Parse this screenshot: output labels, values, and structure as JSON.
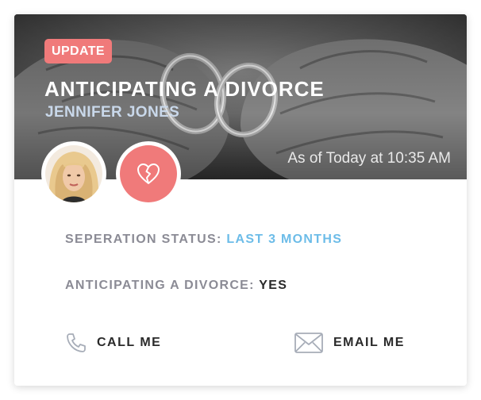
{
  "card": {
    "badge": "UPDATE",
    "title": "ANTICIPATING A DIVORCE",
    "subtitle": "JENNIFER JONES",
    "timestamp": "As of Today at 10:35 AM"
  },
  "details": {
    "separation_label": "SEPERATION STATUS:",
    "separation_value": "LAST 3 MONTHS",
    "divorce_label": "ANTICIPATING A DIVORCE:",
    "divorce_value": "YES"
  },
  "actions": {
    "call_label": "CALL ME",
    "email_label": "EMAIL ME"
  },
  "icons": {
    "badge_icon": "broken-heart-icon",
    "call_icon": "phone-icon",
    "email_icon": "envelope-icon"
  },
  "colors": {
    "accent": "#f07a7a",
    "highlight": "#6cbce8",
    "label": "#8b8b95"
  }
}
